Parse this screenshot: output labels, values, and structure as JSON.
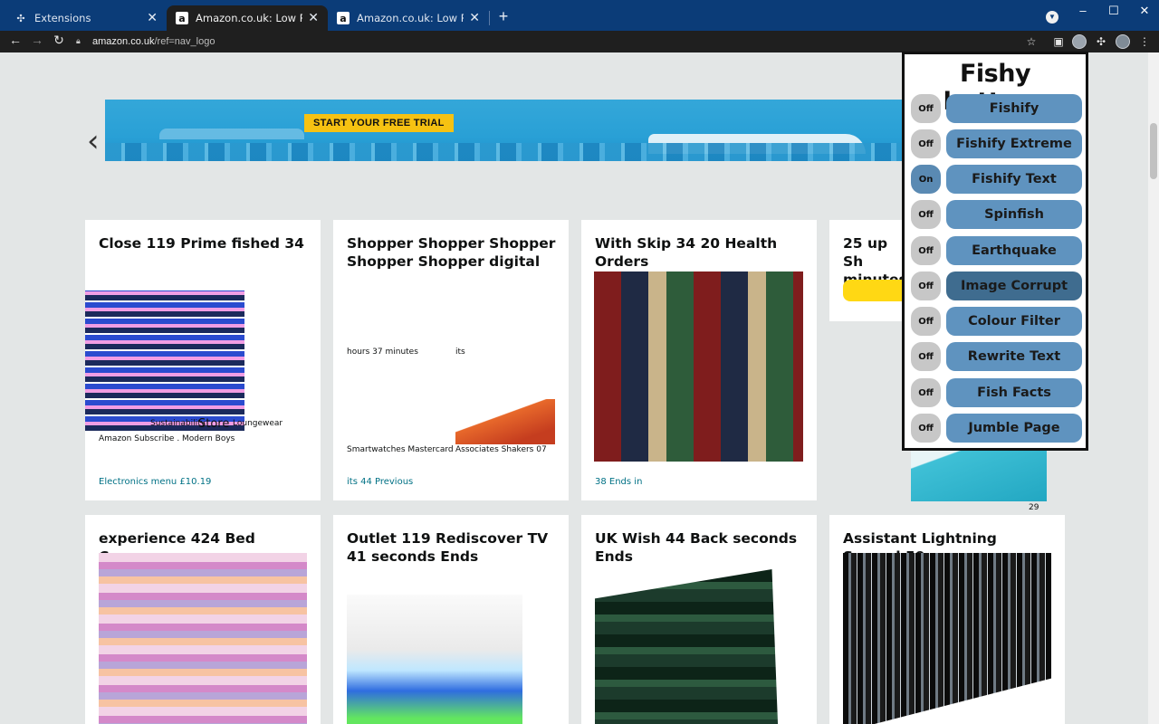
{
  "tabs": [
    {
      "title": "Extensions",
      "icon": "puzzle-icon"
    },
    {
      "title": "Amazon.co.uk: Low Prices in Elec",
      "icon": "amazon-icon"
    },
    {
      "title": "Amazon.co.uk: Low Prices in Elec",
      "icon": "amazon-icon"
    }
  ],
  "address": {
    "host": "amazon.co.uk",
    "path": "/ref=nav_logo"
  },
  "hero": {
    "badge": "START YOUR FREE TRIAL"
  },
  "cards": [
    {
      "title": "Close 119 Prime fished 34",
      "captions": [
        "Amazon Subscribe . Modern Boys"
      ],
      "overlay": [
        "Sustainability",
        "Store",
        "Loungewear"
      ],
      "link": "Electronics menu £10.19"
    },
    {
      "title": "Shopper Shopper Shopper Shopper Shopper digital",
      "labels": [
        "hours 37 minutes",
        "its",
        "Smartwatches Mastercard",
        "Associates Shakers 07"
      ],
      "link": "its 44 Previous"
    },
    {
      "title": "With Skip 34 20 Health Orders",
      "link": "38 Ends in"
    },
    {
      "title": "25 up Sh minutes",
      "ad_label": "29"
    },
    {
      "title": "experience 424 Bed Careers"
    },
    {
      "title": "Outlet 119 Rediscover TV 41 seconds Ends"
    },
    {
      "title": "UK Wish 44 Back seconds Ends"
    },
    {
      "title": "Assistant Lightning Second 59"
    }
  ],
  "panel": {
    "title": "Fishy buttons",
    "rows": [
      {
        "state": "Off",
        "label": "Fishify"
      },
      {
        "state": "Off",
        "label": "Fishify Extreme"
      },
      {
        "state": "On",
        "label": "Fishify Text"
      },
      {
        "state": "Off",
        "label": "Spinfish"
      },
      {
        "state": "Off",
        "label": "Earthquake"
      },
      {
        "state": "Off",
        "label": "Image Corrupt"
      },
      {
        "state": "Off",
        "label": "Colour Filter"
      },
      {
        "state": "Off",
        "label": "Rewrite Text"
      },
      {
        "state": "Off",
        "label": "Fish Facts"
      },
      {
        "state": "Off",
        "label": "Jumble Page"
      }
    ]
  }
}
